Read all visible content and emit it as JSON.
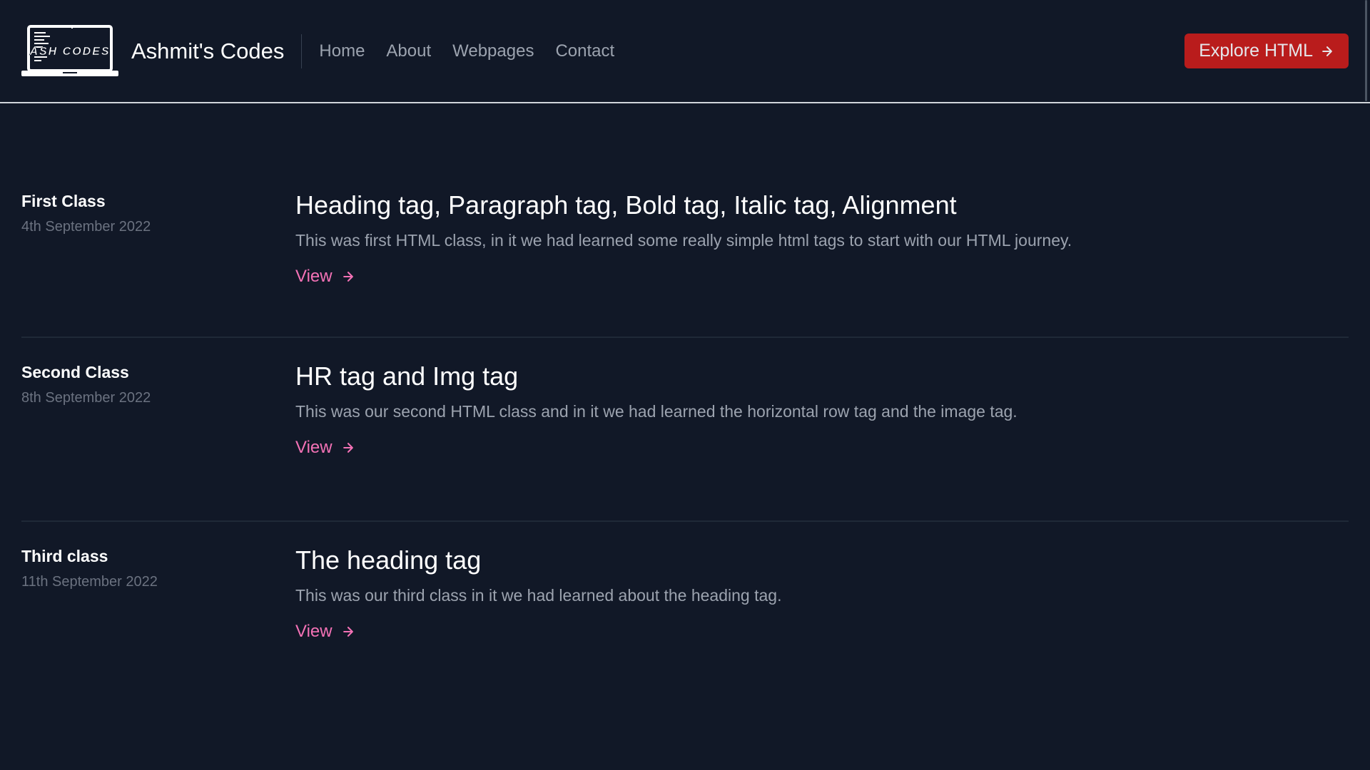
{
  "header": {
    "logo_text": "ASH CODES",
    "brand_name": "Ashmit's Codes",
    "nav": [
      {
        "label": "Home"
      },
      {
        "label": "About"
      },
      {
        "label": "Webpages"
      },
      {
        "label": "Contact"
      }
    ],
    "cta_label": "Explore HTML",
    "cta_icon": "arrow-right-icon"
  },
  "entries": [
    {
      "class_name": "First Class",
      "date": "4th September 2022",
      "title": "Heading tag, Paragraph tag, Bold tag, Italic tag, Alignment",
      "description": "This was first HTML class, in it we had learned some really simple html tags to start with our HTML journey.",
      "link_label": "View"
    },
    {
      "class_name": "Second Class",
      "date": "8th September 2022",
      "title": "HR tag and Img tag",
      "description": "This was our second HTML class and in it we had learned the horizontal row tag and the image tag.",
      "link_label": "View"
    },
    {
      "class_name": "Third class",
      "date": "11th September 2022",
      "title": "The heading tag",
      "description": "This was our third class in it we had learned about the heading tag.",
      "link_label": "View"
    }
  ],
  "colors": {
    "background": "#111827",
    "accent_button": "#b91c1c",
    "link": "#f472b6",
    "heading": "#ffffff",
    "muted": "#9ca3af"
  }
}
